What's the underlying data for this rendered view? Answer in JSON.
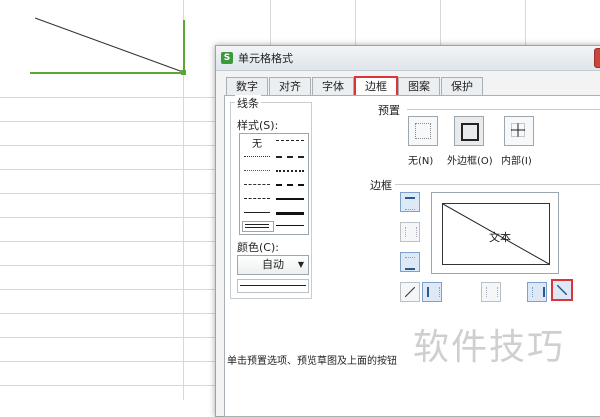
{
  "dialog": {
    "title": "单元格格式",
    "close_label": "×",
    "tabs": [
      {
        "label": "数字"
      },
      {
        "label": "对齐"
      },
      {
        "label": "字体"
      },
      {
        "label": "边框"
      },
      {
        "label": "图案"
      },
      {
        "label": "保护"
      }
    ],
    "active_tab": "边框"
  },
  "line_group": {
    "title": "线条",
    "style_label": "样式(S):",
    "none_label": "无",
    "color_label": "颜色(C):",
    "color_value": "自动",
    "dropdown_arrow": "▼"
  },
  "presets": {
    "title": "预置",
    "items": [
      {
        "label": "无(N)"
      },
      {
        "label": "外边框(O)"
      },
      {
        "label": "内部(I)"
      }
    ]
  },
  "border": {
    "title": "边框",
    "preview_text": "文本"
  },
  "hint": "单击预置选项、预览草图及上面的按钮",
  "watermark": "软件技巧",
  "colors": {
    "accent_red": "#d9353a",
    "green_border": "#5aa832",
    "app_icon_green": "#3a9b3a"
  }
}
